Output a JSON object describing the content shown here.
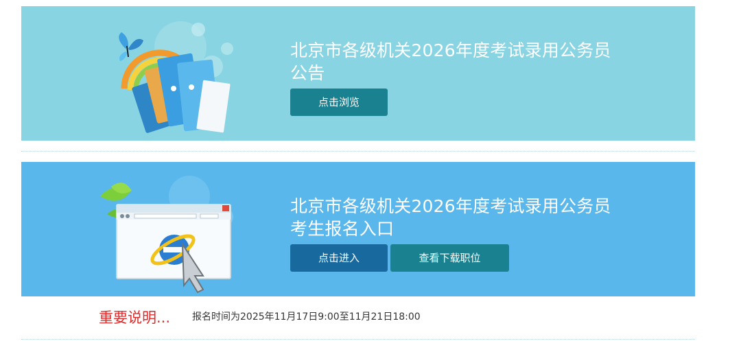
{
  "announcement": {
    "title_line1": "北京市各级机关2026年度考试录用公务员",
    "title_line2": "公告",
    "browse_button": "点击浏览",
    "illustration_icon": "folders-butterfly-icon"
  },
  "registration": {
    "title_line1": "北京市各级机关2026年度考试录用公务员",
    "title_line2": "考生报名入口",
    "enter_button": "点击进入",
    "positions_button": "查看下载职位",
    "illustration_icon": "browser-window-icon"
  },
  "notice": {
    "label": "重要说明...",
    "text": "报名时间为2025年11月17日9:00至11月21日18:00"
  },
  "colors": {
    "announce_bg": "#88d4e2",
    "register_bg": "#59b7eb",
    "teal_button": "#1a8190",
    "blue_button": "#17699e",
    "notice_red": "#e02b2b"
  }
}
